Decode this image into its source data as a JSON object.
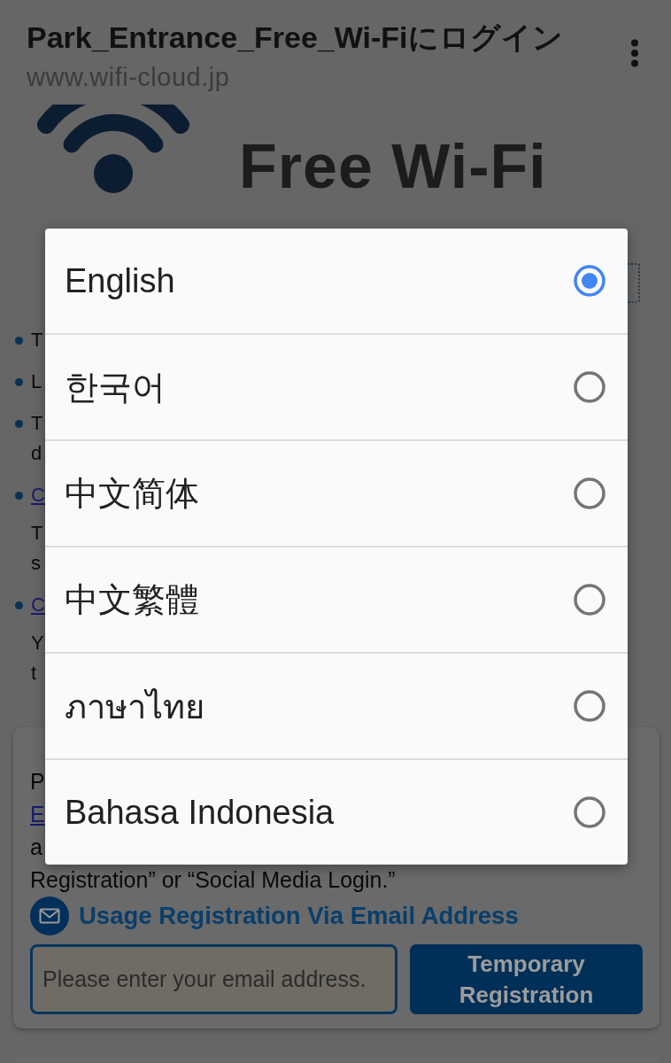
{
  "browser_bar": {
    "title": "Park_Entrance_Free_Wi-Fiにログイン",
    "url": "www.wifi-cloud.jp"
  },
  "logo": {
    "text": "Free Wi-Fi"
  },
  "notes": [
    {
      "lines": [
        "T"
      ]
    },
    {
      "lines": [
        "L"
      ]
    },
    {
      "lines": [
        "T",
        "d"
      ]
    },
    {
      "link": "C",
      "lines": [
        "T",
        "s"
      ]
    },
    {
      "link": "C",
      "lines": [
        "Y",
        "t"
      ]
    }
  ],
  "registration_card": {
    "lines": [
      {
        "kind": "text",
        "text": "P"
      },
      {
        "kind": "link",
        "text": "E"
      },
      {
        "kind": "text",
        "text": "a"
      },
      {
        "kind": "text",
        "text": "Registration” or “Social Media Login.”"
      }
    ],
    "heading": "Usage Registration Via Email Address",
    "email_field": {
      "placeholder": "Please enter your email address."
    },
    "submit_button": "Temporary Registration"
  },
  "language_dialog": {
    "options": [
      {
        "label": "English",
        "selected": true
      },
      {
        "label": "한국어",
        "selected": false
      },
      {
        "label": "中文简体",
        "selected": false
      },
      {
        "label": "中文繁體",
        "selected": false
      },
      {
        "label": "ภาษาไทย",
        "selected": false
      },
      {
        "label": "Bahasa Indonesia",
        "selected": false
      }
    ]
  }
}
